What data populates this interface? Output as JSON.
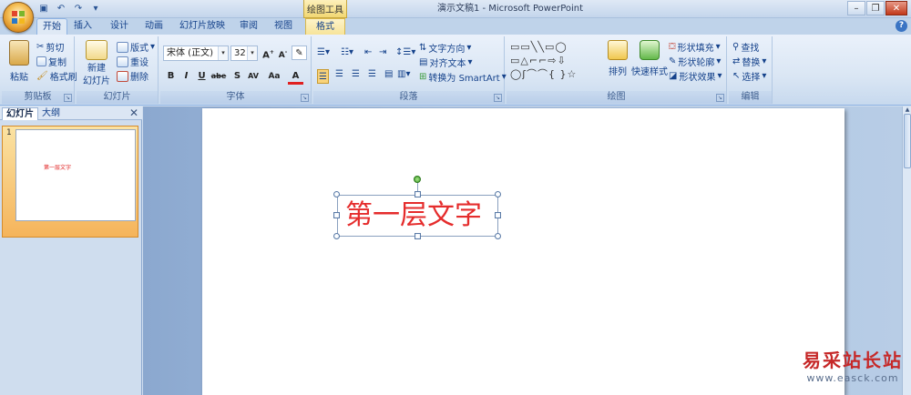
{
  "window": {
    "title": "演示文稿1 - Microsoft PowerPoint",
    "context_tab_title": "绘图工具"
  },
  "tabs": [
    {
      "label": "开始",
      "active": true
    },
    {
      "label": "插入"
    },
    {
      "label": "设计"
    },
    {
      "label": "动画"
    },
    {
      "label": "幻灯片放映"
    },
    {
      "label": "审阅"
    },
    {
      "label": "视图"
    },
    {
      "label": "格式",
      "context": true
    }
  ],
  "ribbon": {
    "clipboard": {
      "label": "剪贴板",
      "paste": "粘贴",
      "cut": "剪切",
      "copy": "复制",
      "format_painter": "格式刷"
    },
    "slides": {
      "label": "幻灯片",
      "new_slide_1": "新建",
      "new_slide_2": "幻灯片",
      "layout": "版式",
      "reset": "重设",
      "delete": "删除"
    },
    "font": {
      "label": "字体",
      "font_name": "宋体 (正文)",
      "font_size": "32"
    },
    "paragraph": {
      "label": "段落",
      "text_direction": "文字方向",
      "align_text": "对齐文本",
      "convert_smartart": "转换为 SmartArt"
    },
    "drawing": {
      "label": "绘图",
      "arrange": "排列",
      "quick_styles": "快速样式",
      "shape_fill": "形状填充",
      "shape_outline": "形状轮廓",
      "shape_effects": "形状效果"
    },
    "editing": {
      "label": "编辑",
      "find": "查找",
      "replace": "替换",
      "select": "选择"
    }
  },
  "panel": {
    "tabs": [
      "幻灯片",
      "大纲"
    ],
    "slide_number": "1",
    "thumb_text": "第一层文字"
  },
  "slide": {
    "text": "第一层文字"
  },
  "watermark": {
    "cn": "易采站长站",
    "url": "www.easck.com"
  },
  "colors": {
    "accent": "#15428b",
    "slide_text": "#e52c2c"
  }
}
